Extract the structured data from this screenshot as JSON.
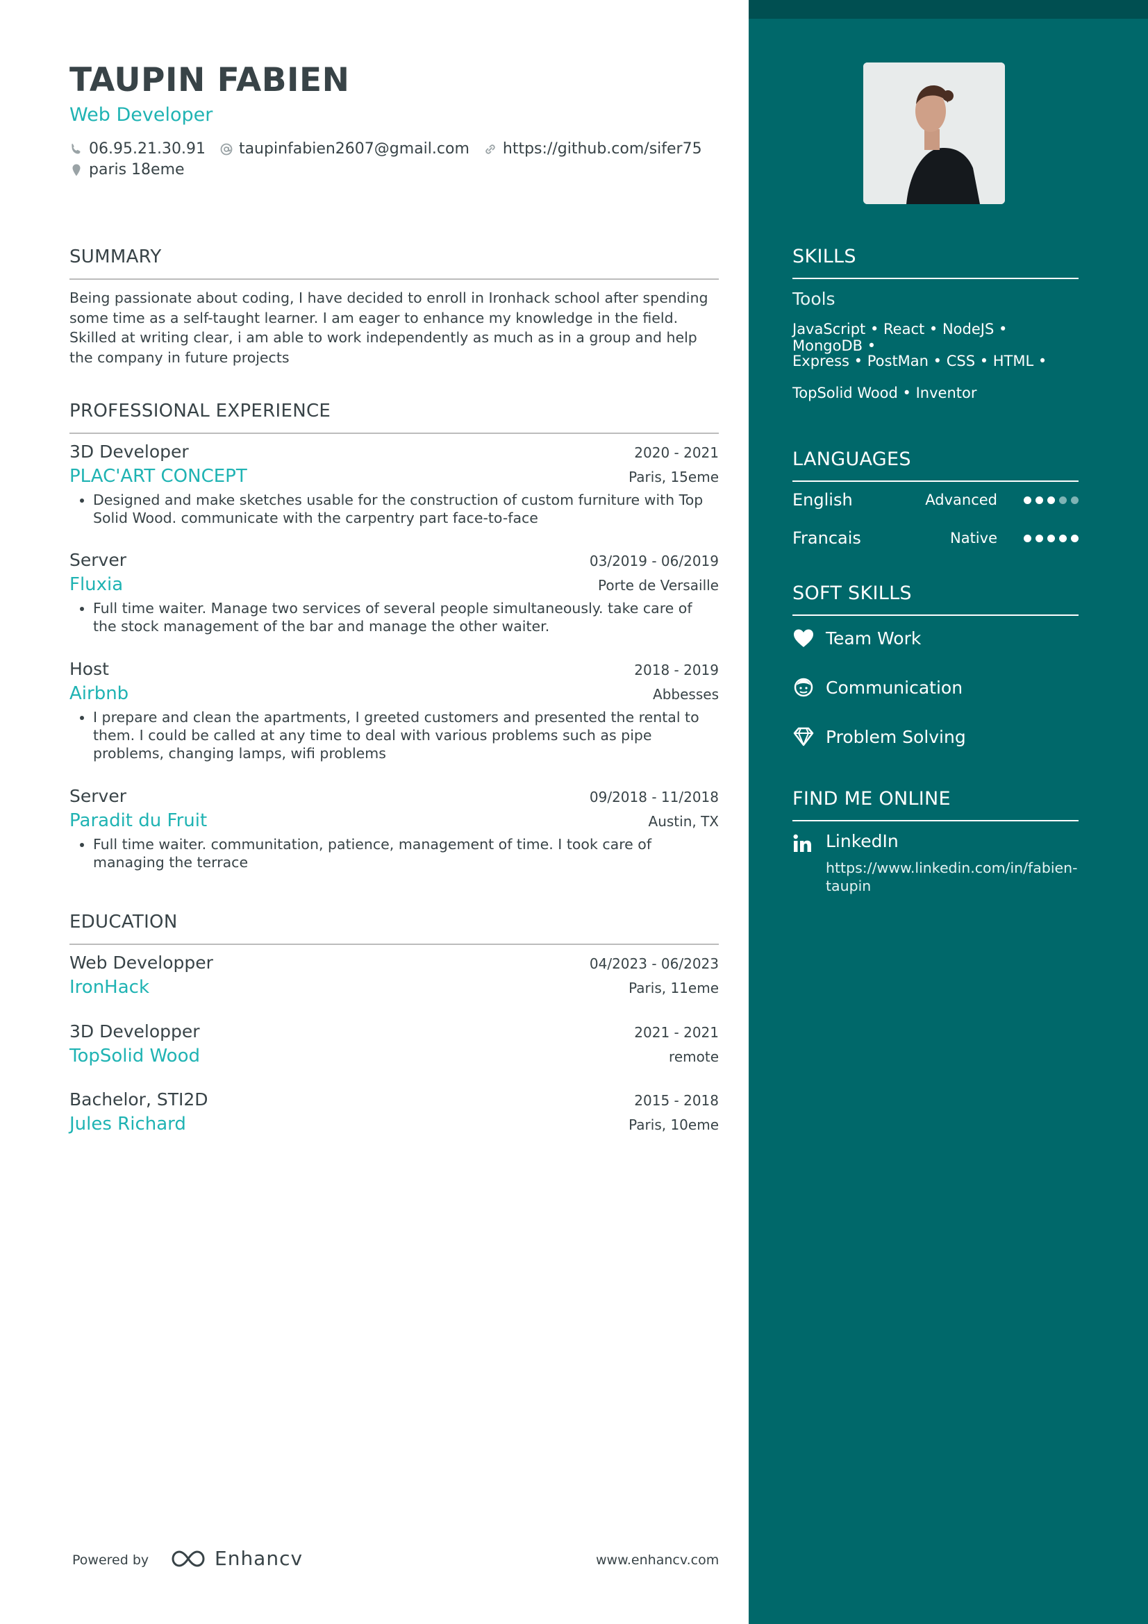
{
  "header": {
    "name": "TAUPIN FABIEN",
    "role": "Web Developer",
    "phone": "06.95.21.30.91",
    "email": "taupinfabien2607@gmail.com",
    "website": "https://github.com/sifer75",
    "location": "paris 18eme"
  },
  "summary": {
    "title": "SUMMARY",
    "text": "Being passionate about coding, I have decided to enroll in Ironhack school after spending some time as a self-taught learner. I am eager to enhance my knowledge in the field. Skilled at writing clear, i am able to work independently as much as in a group and help the company in future projects"
  },
  "experience": {
    "title": "PROFESSIONAL EXPERIENCE",
    "items": [
      {
        "title": "3D Developer",
        "date": "2020 - 2021",
        "org": "PLAC'ART CONCEPT",
        "location": "Paris, 15eme",
        "bullet": "Designed and make sketches usable for the construction of custom furniture with Top Solid Wood. communicate with the carpentry part face-to-face"
      },
      {
        "title": "Server",
        "date": "03/2019 - 06/2019",
        "org": "Fluxia",
        "location": "Porte de Versaille",
        "bullet": "Full time waiter. Manage two services of several people simultaneously. take care of the stock management of the bar and manage the other waiter."
      },
      {
        "title": "Host",
        "date": "2018 - 2019",
        "org": "Airbnb",
        "location": "Abbesses",
        "bullet": "I prepare and clean the apartments, I greeted customers and presented the rental to them. I could be called at any time to deal with various problems such as pipe problems, changing lamps, wifi problems"
      },
      {
        "title": "Server",
        "date": "09/2018 - 11/2018",
        "org": "Paradit du Fruit",
        "location": "Austin, TX",
        "bullet": "Full time waiter. communitation, patience, management of time. I took care of managing the terrace"
      }
    ]
  },
  "education": {
    "title": "EDUCATION",
    "items": [
      {
        "title": "Web Developper",
        "date": "04/2023 - 06/2023",
        "org": "IronHack",
        "location": "Paris, 11eme"
      },
      {
        "title": "3D Developper",
        "date": "2021 - 2021",
        "org": "TopSolid Wood",
        "location": "remote"
      },
      {
        "title": "Bachelor, STI2D",
        "date": "2015 - 2018",
        "org": "Jules Richard",
        "location": "Paris, 10eme"
      }
    ]
  },
  "skills": {
    "title": "SKILLS",
    "group": "Tools",
    "lines": [
      "JavaScript • React • NodeJS • MongoDB •",
      "Express • PostMan • CSS • HTML •",
      "TopSolid Wood • Inventor"
    ]
  },
  "languages": {
    "title": "LANGUAGES",
    "items": [
      {
        "name": "English",
        "level": "Advanced",
        "dots_filled": 3,
        "dots_total": 5
      },
      {
        "name": "Francais",
        "level": "Native",
        "dots_filled": 5,
        "dots_total": 5
      }
    ]
  },
  "soft_skills": {
    "title": "SOFT SKILLS",
    "items": [
      {
        "label": "Team Work",
        "icon": "heart-icon"
      },
      {
        "label": "Communication",
        "icon": "face-icon"
      },
      {
        "label": "Problem Solving",
        "icon": "diamond-icon"
      }
    ]
  },
  "online": {
    "title": "FIND ME ONLINE",
    "label": "LinkedIn",
    "url": "https://www.linkedin.com/in/fabien-taupin",
    "icon": "linkedin-icon"
  },
  "footer": {
    "powered_by": "Powered by",
    "brand": "Enhancv",
    "site": "www.enhancv.com"
  },
  "colors": {
    "accent": "#1fb3b3",
    "sidebar": "#00686a",
    "text": "#384347"
  }
}
